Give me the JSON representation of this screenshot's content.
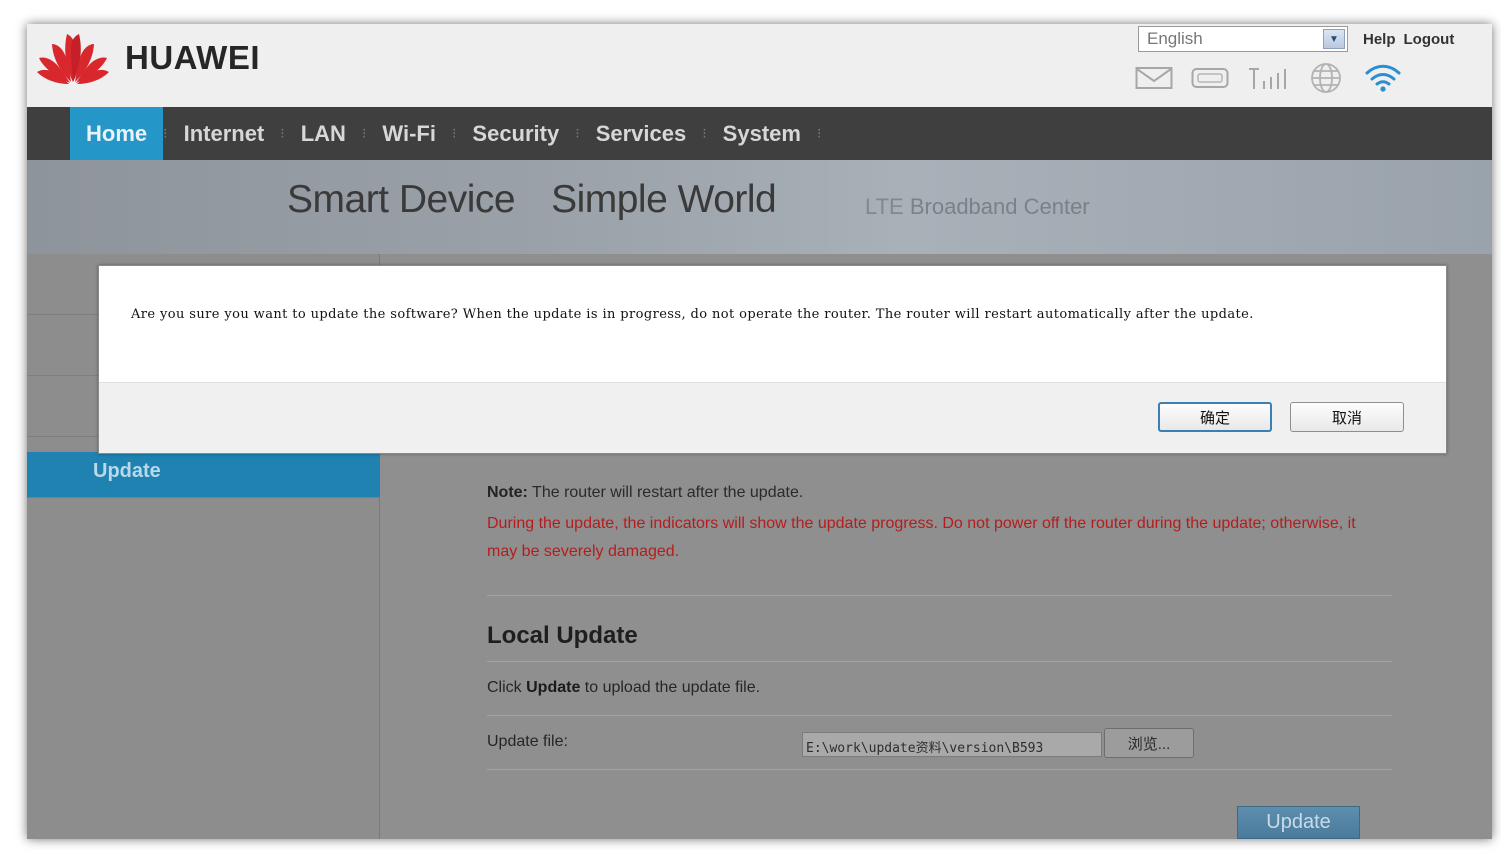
{
  "brand": {
    "name": "HUAWEI"
  },
  "header": {
    "language": "English",
    "links": [
      "Help",
      "Logout"
    ],
    "status_icons": [
      "mail-icon",
      "usb-icon",
      "signal-icon",
      "globe-icon",
      "wifi-icon"
    ]
  },
  "nav": {
    "items": [
      {
        "label": "Home",
        "active": true
      },
      {
        "label": "Internet"
      },
      {
        "label": "LAN"
      },
      {
        "label": "Wi-Fi"
      },
      {
        "label": "Security"
      },
      {
        "label": "Services"
      },
      {
        "label": "System"
      }
    ]
  },
  "banner": {
    "slogan_1": "Smart Device",
    "slogan_2": "Simple World",
    "sub_lte": "LTE",
    "sub_rest": "Broadband Center"
  },
  "sidebar": {
    "active_item": "Update"
  },
  "main": {
    "note_label": "Note:",
    "note_text": " The router will restart after the update.",
    "warning": "During the update, the indicators will show the update progress. Do not power off the router during the update; otherwise, it may be severely damaged.",
    "section_title": "Local Update",
    "click_prefix": "Click ",
    "click_bold": "Update",
    "click_suffix": " to upload the update file.",
    "file_label": "Update file:",
    "file_value": "E:\\work\\update资料\\version\\B593",
    "browse_label": "浏览...",
    "update_label": "Update"
  },
  "modal": {
    "message": "Are you sure you want to update the software? When the update is in progress, do not operate the router. The router will restart automatically after the update.",
    "ok_label": "确定",
    "cancel_label": "取消"
  },
  "colors": {
    "nav_active": "#2596c8",
    "sidebar_active": "#1f82b1",
    "warning_text": "#b51d1d",
    "logo_red": "#d9272e"
  }
}
